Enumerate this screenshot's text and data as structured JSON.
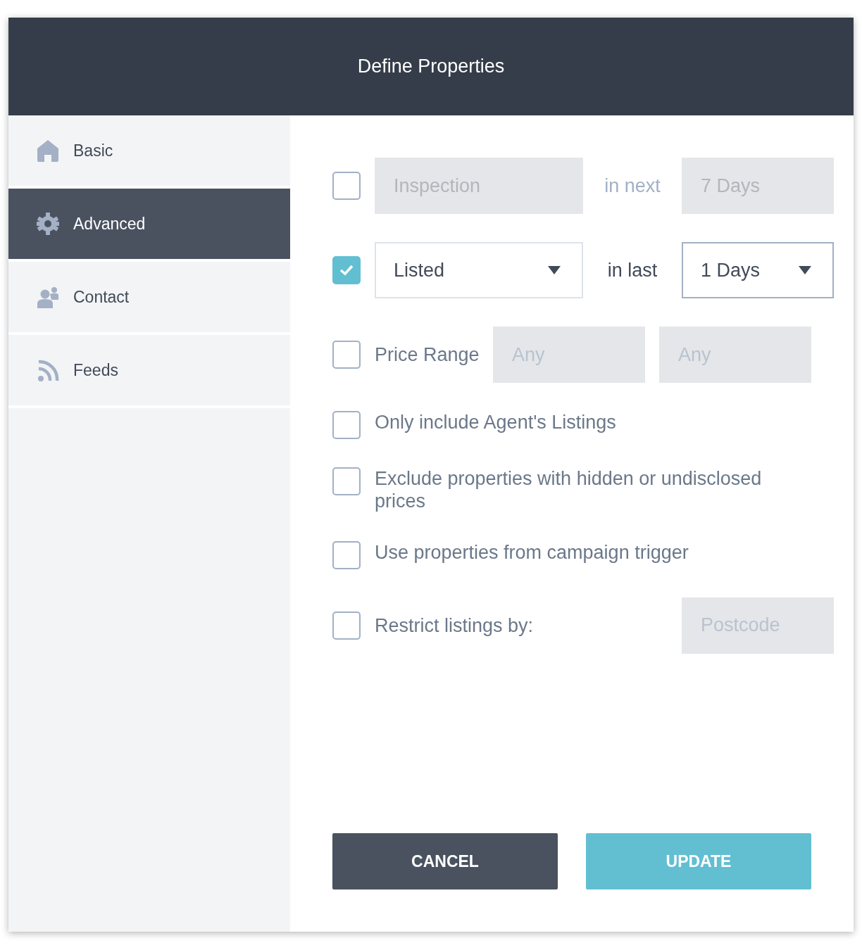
{
  "window": {
    "title": "Define Properties"
  },
  "sidebar": {
    "items": [
      {
        "label": "Basic",
        "selected": false
      },
      {
        "label": "Advanced",
        "selected": true
      },
      {
        "label": "Contact",
        "selected": false
      },
      {
        "label": "Feeds",
        "selected": false
      }
    ]
  },
  "options": [
    {
      "kind": "range",
      "checked": false,
      "field": "Inspection",
      "connector": "in next",
      "period": "7 Days"
    },
    {
      "kind": "range",
      "checked": true,
      "field": "Listed",
      "connector": "in last",
      "period": "1 Days"
    },
    {
      "kind": "price",
      "checked": false,
      "label": "Price Range",
      "min_placeholder": "Any",
      "max_placeholder": "Any"
    },
    {
      "kind": "check",
      "checked": false,
      "label": "Only include Agent's Listings"
    },
    {
      "kind": "check",
      "checked": false,
      "label": "Exclude properties with hidden or undisclosed prices"
    },
    {
      "kind": "check",
      "checked": false,
      "label": "Use properties from campaign trigger"
    },
    {
      "kind": "restrict",
      "checked": false,
      "label": "Restrict listings by:",
      "placeholder": "Postcode"
    }
  ],
  "buttons": [
    {
      "label": "CANCEL",
      "kind": "secondary"
    },
    {
      "label": "UPDATE",
      "kind": "primary"
    }
  ]
}
